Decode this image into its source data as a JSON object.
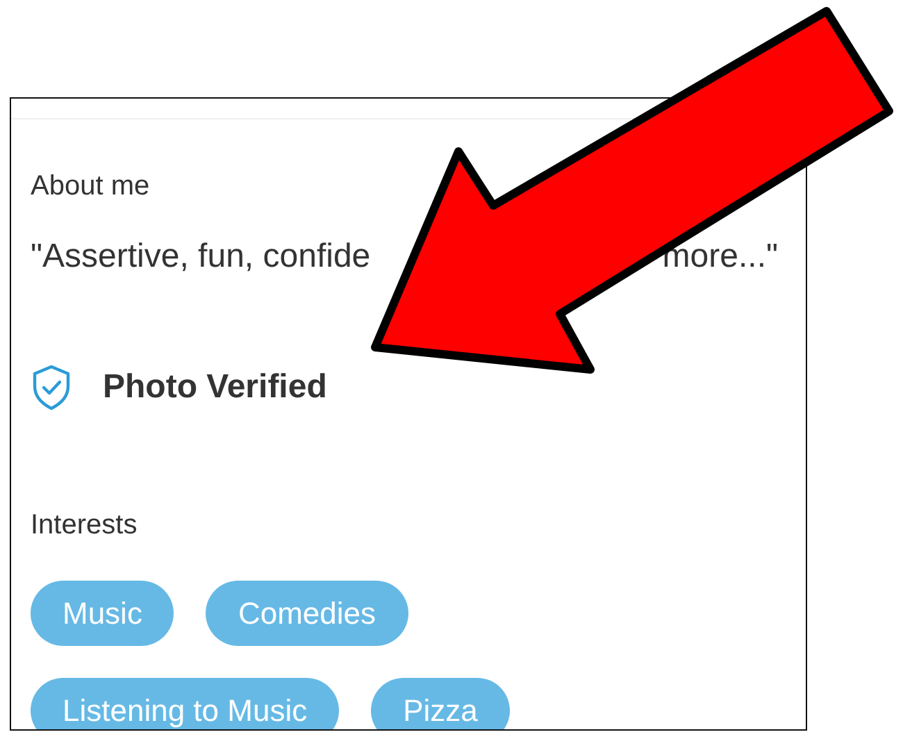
{
  "about": {
    "heading": "About me",
    "quote_start": "\"Assertive, fun, confide",
    "quote_end": "more...\""
  },
  "verification": {
    "label": "Photo Verified",
    "verified": true
  },
  "interests": {
    "heading": "Interests",
    "tags": [
      "Music",
      "Comedies",
      "Listening to Music",
      "Pizza"
    ]
  }
}
